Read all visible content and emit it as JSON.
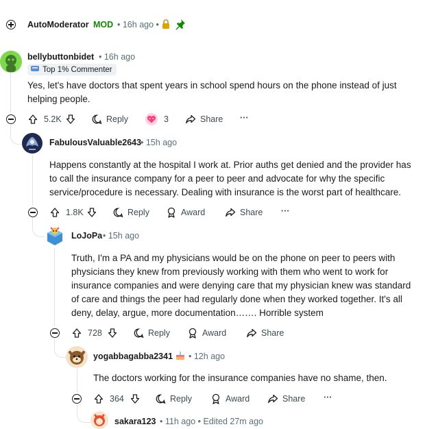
{
  "automod": {
    "author": "AutoModerator",
    "mod_label": "MOD",
    "time": "16h ago"
  },
  "comments": [
    {
      "author": "bellybuttonbidet",
      "time": "16h ago",
      "flair": "Top 1% Commenter",
      "text": "Yes, let's have doctors that spent years in school spend hours on the phone instead of just helping people.",
      "votes": "5.2K",
      "reply_label": "Reply",
      "award_count": "3",
      "share_label": "Share",
      "more_label": "···"
    },
    {
      "author": "FabulousValuable2643",
      "time": "15h ago",
      "text": "Happens constantly at the hospital I work at. Prior auths get denied and the provider has to call the insurance company for a peer to peer and advocate for why the specific service/procedure is necessary. Dealing with insurance is the worst part of healthcare.",
      "votes": "1.8K",
      "reply_label": "Reply",
      "award_label": "Award",
      "share_label": "Share",
      "more_label": "···"
    },
    {
      "author": "LoJoPa",
      "time": "15h ago",
      "text": "Truth, I'm a PA and my physicians would be on the phone on peer to peers with physicians they knew from previously working with them who went to work for insurance companies and were denying care that my physician knew was standard of care and things the peer had regularly done when they worked together. It's all deny, delay, argue, more documentation……. Horrible system",
      "votes": "728",
      "reply_label": "Reply",
      "award_label": "Award",
      "share_label": "Share"
    },
    {
      "author": "yogabbagabba2341",
      "time": "12h ago",
      "text": "The doctors working for the insurance companies have no shame, then.",
      "votes": "364",
      "reply_label": "Reply",
      "award_label": "Award",
      "share_label": "Share",
      "more_label": "···"
    },
    {
      "author": "sakara123",
      "time": "11h ago",
      "edited": "Edited 27m ago"
    }
  ],
  "colors": {
    "mod_green": "#0e8a00",
    "meta_gray": "#576f76",
    "thread_line": "#dfe3e6"
  }
}
